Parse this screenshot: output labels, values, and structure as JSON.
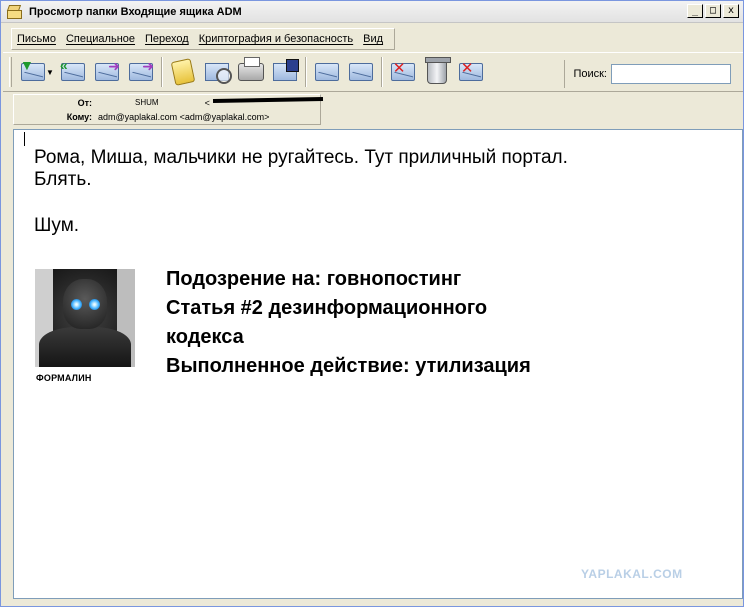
{
  "window": {
    "title": "Просмотр папки Входящие ящика ADM",
    "controls": {
      "minimize": "_",
      "maximize": "□",
      "close": "x"
    }
  },
  "menu": {
    "items": [
      "Письмо",
      "Специальное",
      "Переход",
      "Криптография и безопасность",
      "Вид"
    ]
  },
  "toolbar": {
    "search_label": "Поиск:",
    "search_value": ""
  },
  "header": {
    "from_label": "От:",
    "from_name": "SHUM",
    "from_email_prefix": "<",
    "to_label": "Кому:",
    "to_value": "adm@yaplakal.com <adm@yaplakal.com>"
  },
  "message": {
    "line1": "Рома, Миша, мальчики не ругайтесь. Тут приличный портал.",
    "line2": "Блять.",
    "line3": "Шум.",
    "avatar_caption": "ФОРМАЛИН",
    "verdict": [
      "Подозрение на: говнопостинг",
      "Статья #2 дезинформационного",
      "кодекса",
      "Выполненное действие: утилизация"
    ],
    "watermark": "YAPLAKAL.COM"
  }
}
